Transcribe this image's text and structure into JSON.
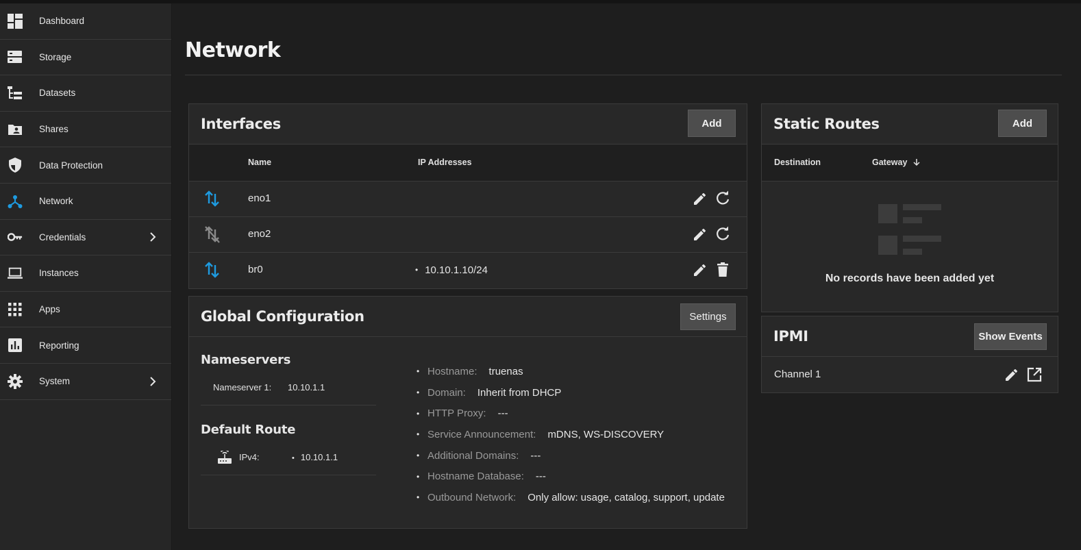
{
  "sidebar": {
    "items": [
      {
        "label": "Dashboard",
        "icon": "dashboard-icon"
      },
      {
        "label": "Storage",
        "icon": "storage-icon"
      },
      {
        "label": "Datasets",
        "icon": "datasets-icon"
      },
      {
        "label": "Shares",
        "icon": "shares-icon"
      },
      {
        "label": "Data Protection",
        "icon": "shield-icon"
      },
      {
        "label": "Network",
        "icon": "network-icon",
        "active": true
      },
      {
        "label": "Credentials",
        "icon": "key-icon",
        "expandable": true
      },
      {
        "label": "Instances",
        "icon": "laptop-icon"
      },
      {
        "label": "Apps",
        "icon": "apps-grid-icon"
      },
      {
        "label": "Reporting",
        "icon": "reporting-icon"
      },
      {
        "label": "System",
        "icon": "gear-icon",
        "expandable": true
      }
    ]
  },
  "page": {
    "title": "Network"
  },
  "interfaces": {
    "title": "Interfaces",
    "add_label": "Add",
    "columns": {
      "name": "Name",
      "ip": "IP Addresses"
    },
    "rows": [
      {
        "name": "eno1",
        "ip": "",
        "status": "link-up",
        "actions": [
          "edit",
          "reset"
        ]
      },
      {
        "name": "eno2",
        "ip": "",
        "status": "link-down",
        "actions": [
          "edit",
          "reset"
        ]
      },
      {
        "name": "br0",
        "ip": "10.10.1.10/24",
        "status": "link-up",
        "actions": [
          "edit",
          "delete"
        ]
      }
    ]
  },
  "global_config": {
    "title": "Global Configuration",
    "settings_label": "Settings",
    "nameservers_heading": "Nameservers",
    "nameserver1_label": "Nameserver 1:",
    "nameserver1_value": "10.10.1.1",
    "default_route_heading": "Default Route",
    "ipv4_label": "IPv4:",
    "ipv4_value": "10.10.1.1",
    "details": [
      {
        "label": "Hostname:",
        "value": "truenas"
      },
      {
        "label": "Domain:",
        "value": "Inherit from DHCP"
      },
      {
        "label": "HTTP Proxy:",
        "value": "---"
      },
      {
        "label": "Service Announcement:",
        "value": "mDNS, WS-DISCOVERY"
      },
      {
        "label": "Additional Domains:",
        "value": "---"
      },
      {
        "label": "Hostname Database:",
        "value": "---"
      },
      {
        "label": "Outbound Network:",
        "value": "Only allow: usage, catalog, support, update"
      }
    ]
  },
  "static_routes": {
    "title": "Static Routes",
    "add_label": "Add",
    "columns": {
      "destination": "Destination",
      "gateway": "Gateway"
    },
    "empty_text": "No records have been added yet"
  },
  "ipmi": {
    "title": "IPMI",
    "show_events_label": "Show Events",
    "channel_label": "Channel 1"
  },
  "colors": {
    "accent": "#1e9be0",
    "background": "#1e1e1e",
    "card": "#282828",
    "sidebar": "#262626"
  }
}
